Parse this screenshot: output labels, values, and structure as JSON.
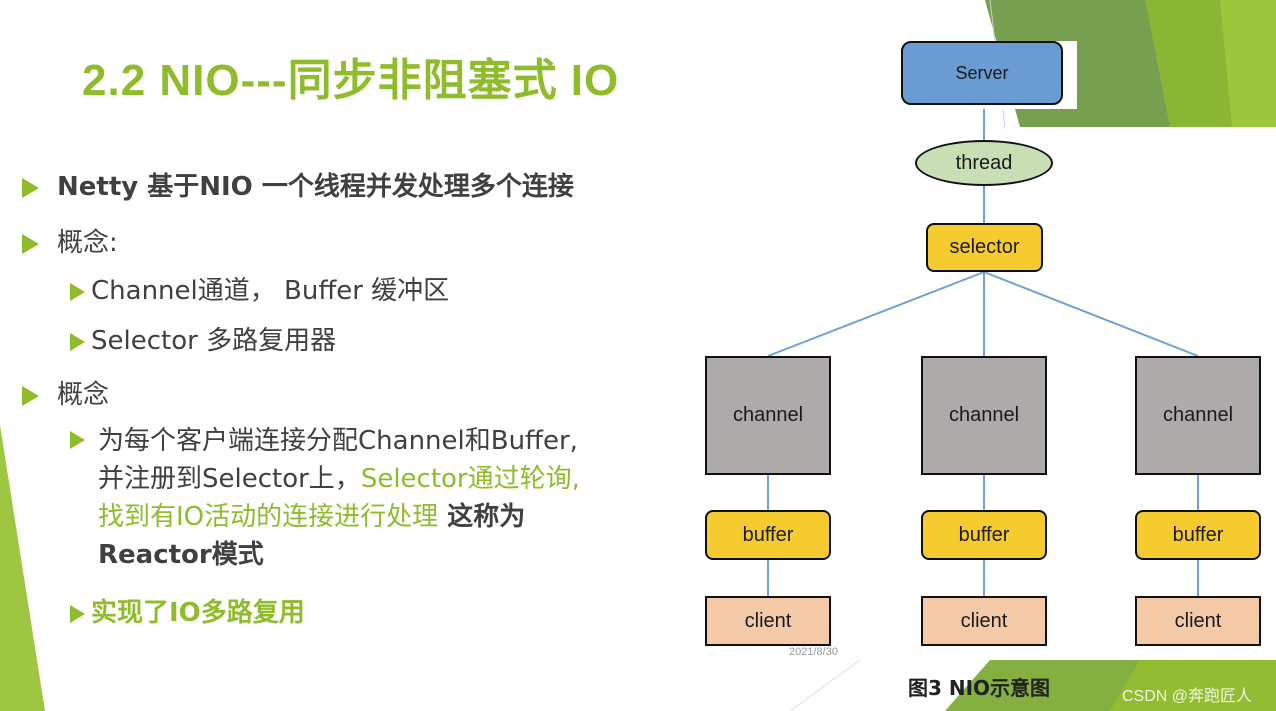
{
  "slide": {
    "title": "2.2 NIO---同步非阻塞式 IO",
    "accent_color": "#8fbc2a",
    "bullets": [
      {
        "level": 1,
        "text": "Netty 基于NIO 一个线程并发处理多个连接",
        "bold": true
      },
      {
        "level": 1,
        "text": "概念:"
      },
      {
        "level": 2,
        "text": "Channel通道，  Buffer 缓冲区"
      },
      {
        "level": 2,
        "text": "Selector 多路复用器"
      },
      {
        "level": 1,
        "text": "概念"
      },
      {
        "level": 2,
        "parts": {
          "p1": "为每个客户端连接分配Channel和Buffer,",
          "p2a": "并注册到Selector上，",
          "p2b": "Selector通过轮询,",
          "p3a": "找到有IO活动的连接进行处理",
          "p3b": " 这称为",
          "p4": "Reactor模式"
        }
      },
      {
        "level": 2,
        "text": "实现了IO多路复用",
        "green": true
      }
    ],
    "date": "2021/8/30",
    "watermark": "CSDN @奔跑匠人"
  },
  "diagram": {
    "caption": "图3  NIO示意图",
    "server": "Server",
    "thread": "thread",
    "selector": "selector",
    "columns": [
      {
        "channel": "channel",
        "buffer": "buffer",
        "client": "client"
      },
      {
        "channel": "channel",
        "buffer": "buffer",
        "client": "client"
      },
      {
        "channel": "channel",
        "buffer": "buffer",
        "client": "client"
      }
    ],
    "colors": {
      "server": "#6a9bd2",
      "thread": "#c8deb4",
      "selector": "#f6cb30",
      "channel": "#aeaaaa",
      "buffer": "#f6cb30",
      "client": "#f4c9a8",
      "connector": "#6fa0d8"
    }
  }
}
